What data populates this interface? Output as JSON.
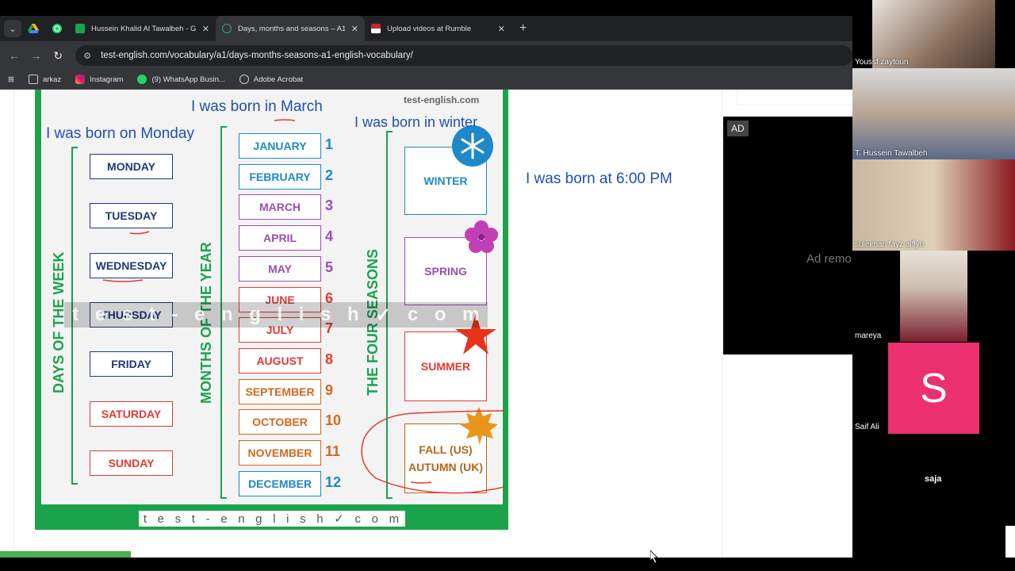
{
  "browser": {
    "tabs": [
      {
        "label": "Hussein Khalid Al Tawalbeh - Go",
        "active": false,
        "favicon_color": "#1aa34a"
      },
      {
        "label": "Days, months and seasons – A1",
        "active": true,
        "favicon_color": "#3aa757"
      },
      {
        "label": "Upload videos at Rumble",
        "active": false,
        "favicon_color": "#c62828"
      }
    ],
    "url": "test-english.com/vocabulary/a1/days-months-seasons-a1-english-vocabulary/",
    "bookmarks": [
      {
        "label": "arkaz",
        "icon": "folder-icon"
      },
      {
        "label": "Instagram",
        "icon": "instagram-icon"
      },
      {
        "label": "(9) WhatsApp Busin...",
        "icon": "whatsapp-icon"
      },
      {
        "label": "Adobe Acrobat",
        "icon": "acrobat-icon"
      }
    ]
  },
  "annotations": {
    "month": "I was born in March",
    "day": "I was born on Monday",
    "season": "I was born in winter",
    "time": "I was born at 6:00 PM"
  },
  "chart": {
    "days_label": "DAYS OF THE WEEK",
    "months_label": "MONTHS OF THE YEAR",
    "seasons_label": "THE FOUR SEASONS",
    "watermark": "test-english.com",
    "site_footer": [
      "t",
      "e",
      "s",
      "t",
      "-",
      "e",
      "n",
      "g",
      "l",
      "i",
      "s",
      "h",
      "✓",
      "c",
      "o",
      "m"
    ],
    "overlay_letters": [
      "t",
      "e",
      "s",
      "t",
      "-",
      "e",
      "n",
      "g",
      "l",
      "i",
      "s",
      "h",
      "✓",
      "c",
      "o",
      "m"
    ],
    "days": [
      {
        "label": "MONDAY",
        "color": "#1e3a7a"
      },
      {
        "label": "TUESDAY",
        "color": "#1e3a7a"
      },
      {
        "label": "WEDNESDAY",
        "color": "#1e3a7a"
      },
      {
        "label": "THURSDAY",
        "color": "#1e3a7a"
      },
      {
        "label": "FRIDAY",
        "color": "#1e3a7a"
      },
      {
        "label": "SATURDAY",
        "color": "#e53935"
      },
      {
        "label": "SUNDAY",
        "color": "#e53935"
      }
    ],
    "months": [
      {
        "label": "JANUARY",
        "num": "1",
        "color": "#1e88c8"
      },
      {
        "label": "FEBRUARY",
        "num": "2",
        "color": "#1e88c8"
      },
      {
        "label": "MARCH",
        "num": "3",
        "color": "#9c4fb0"
      },
      {
        "label": "APRIL",
        "num": "4",
        "color": "#9c4fb0"
      },
      {
        "label": "MAY",
        "num": "5",
        "color": "#9c4fb0"
      },
      {
        "label": "JUNE",
        "num": "6",
        "color": "#e53935"
      },
      {
        "label": "JULY",
        "num": "7",
        "color": "#e53935"
      },
      {
        "label": "AUGUST",
        "num": "8",
        "color": "#e53935"
      },
      {
        "label": "SEPTEMBER",
        "num": "9",
        "color": "#d2691e"
      },
      {
        "label": "OCTOBER",
        "num": "10",
        "color": "#d2691e"
      },
      {
        "label": "NOVEMBER",
        "num": "11",
        "color": "#d2691e"
      },
      {
        "label": "DECEMBER",
        "num": "12",
        "color": "#1e88c8"
      }
    ],
    "seasons": [
      {
        "label": "WINTER",
        "color": "#1e88c8",
        "icon": "snowflake-icon"
      },
      {
        "label": "SPRING",
        "color": "#9c4fb0",
        "icon": "flower-icon"
      },
      {
        "label": "SUMMER",
        "color": "#e53935",
        "icon": "starfish-icon"
      },
      {
        "label": "FALL (US)\nAUTUMN (UK)",
        "color": "#b5651d",
        "icon": "maple-leaf-icon"
      }
    ]
  },
  "ad": {
    "badge": "AD",
    "remove_text": "Ad remo"
  },
  "participants": [
    {
      "name": "Youssf zaytoun"
    },
    {
      "name": "T. Hussein Tawalbeh"
    },
    {
      "name": "suleiman fayz alflyh"
    },
    {
      "name": "mareya"
    },
    {
      "name": "Saif Ali",
      "avatar_letter": "S"
    },
    {
      "name": "saja"
    }
  ]
}
